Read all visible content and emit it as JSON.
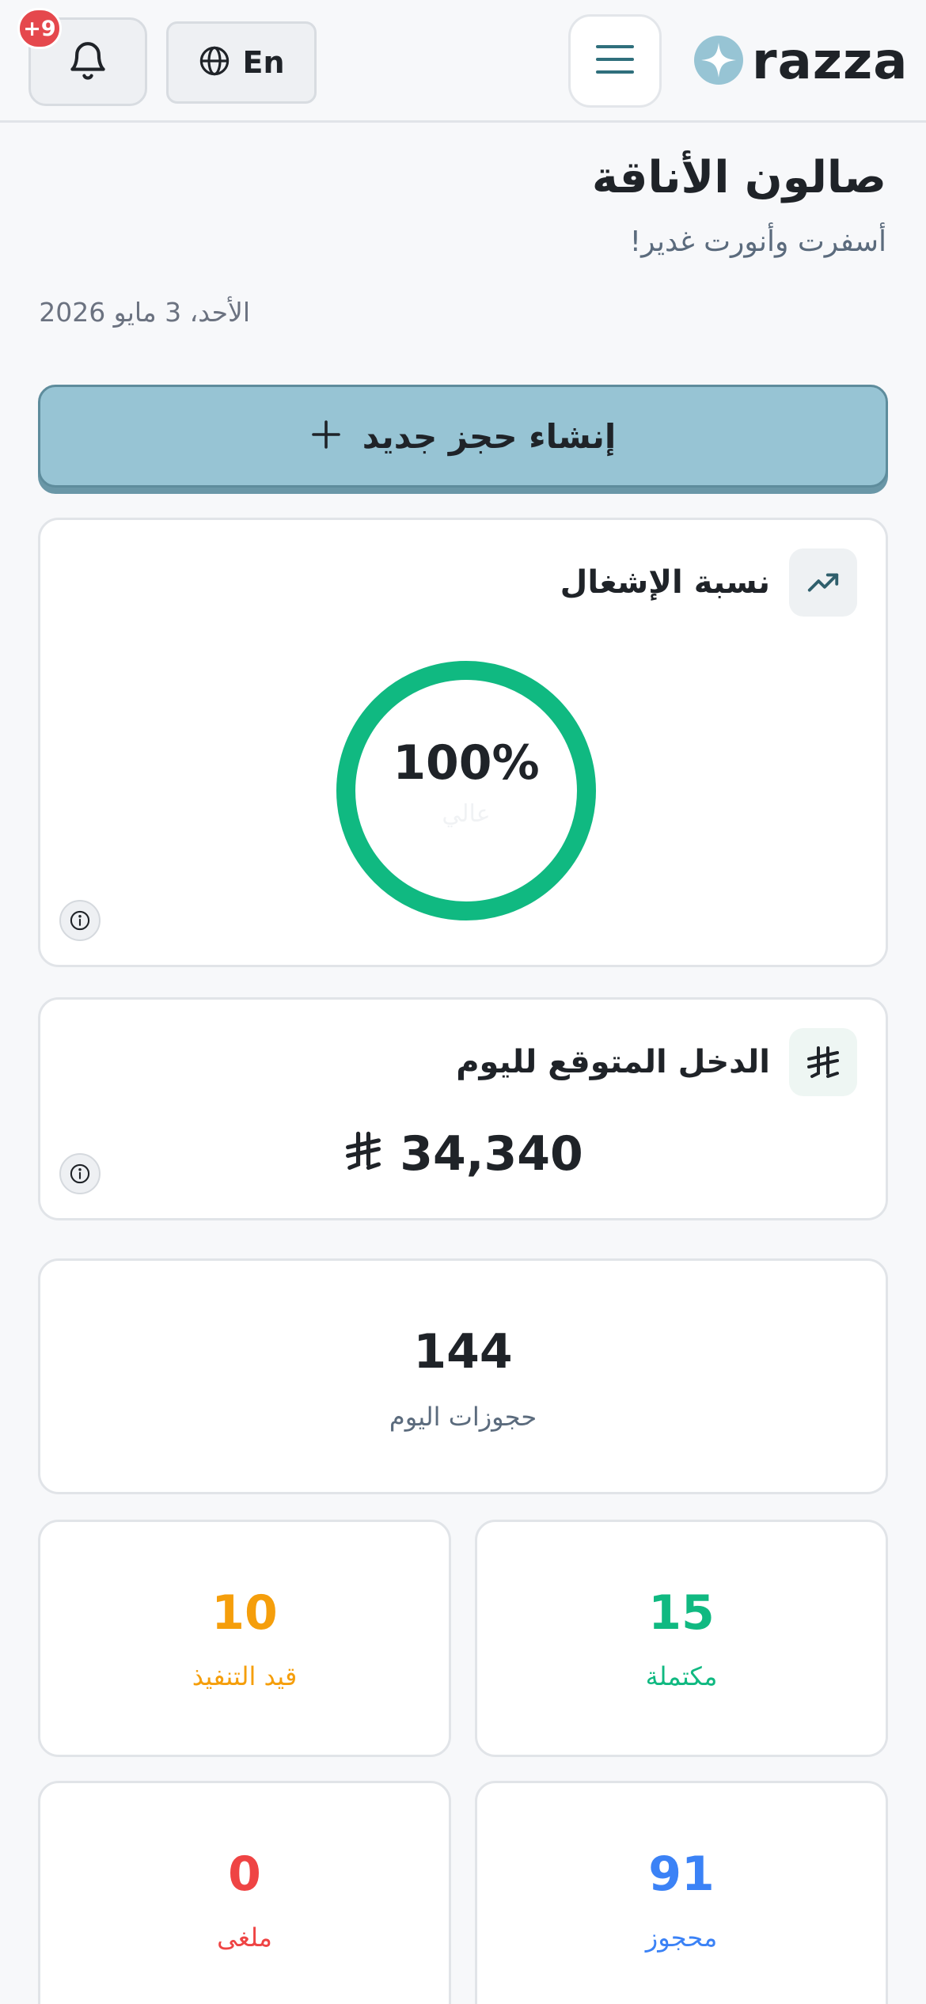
{
  "header": {
    "notifications_badge": "+9",
    "language_label": "En",
    "logo_text": "razza",
    "icons": {
      "bell": "bell-icon",
      "globe": "globe-icon",
      "menu": "hamburger-menu-icon",
      "logo": "sparkle-logo-icon"
    }
  },
  "page": {
    "salon_name": "صالون الأناقة",
    "greeting": "أسفرت وأنورت غدير!",
    "date": "الأحد، 3 مايو 2026"
  },
  "actions": {
    "new_booking_label": "إنشاء حجز جديد"
  },
  "occupancy": {
    "title": "نسبة الإشغال",
    "value_text": "100%",
    "value": 100,
    "level_label": "عالي"
  },
  "income": {
    "title": "الدخل المتوقع لليوم",
    "value": "34,340"
  },
  "stats": {
    "total": {
      "value": "144",
      "label": "حجوزات اليوم"
    },
    "completed": {
      "value": "15",
      "label": "مكتملة",
      "color": "#10b981"
    },
    "in_progress": {
      "value": "10",
      "label": "قيد التنفيذ",
      "color": "#f59e0b"
    },
    "booked": {
      "value": "91",
      "label": "محجوز",
      "color": "#3b82f6"
    },
    "cancelled": {
      "value": "0",
      "label": "ملغى",
      "color": "#ef4444"
    }
  },
  "colors": {
    "accent": "#97c4d4",
    "ring": "#10b981",
    "badge": "#e5484d"
  }
}
